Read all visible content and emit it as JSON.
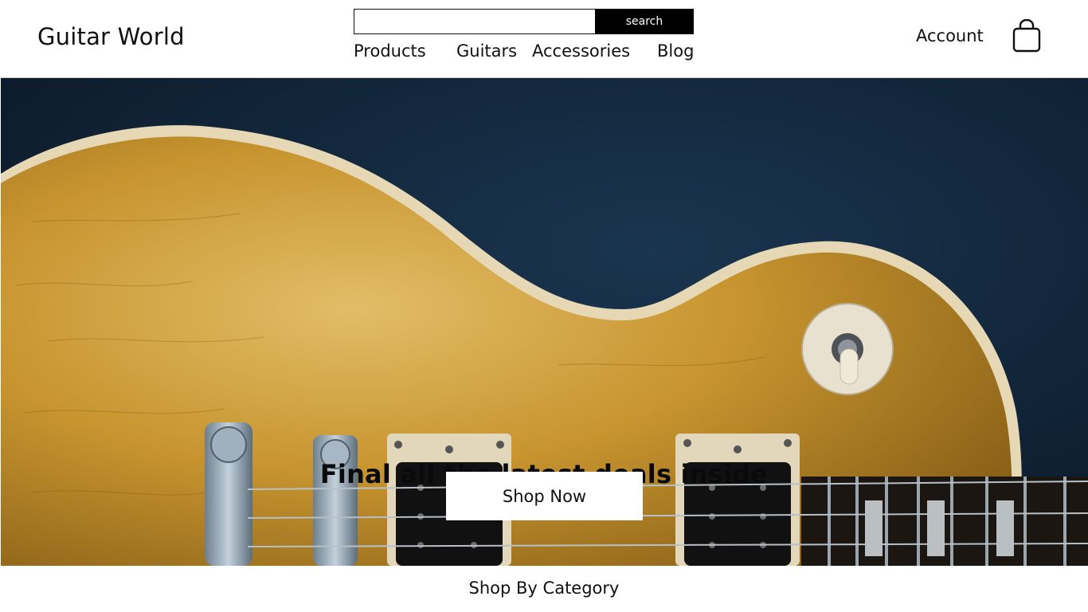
{
  "header": {
    "brand": "Guitar World",
    "search": {
      "value": "",
      "placeholder": "",
      "button_label": "search"
    },
    "nav": [
      {
        "label": "Products"
      },
      {
        "label": "Guitars"
      },
      {
        "label": "Accessories"
      },
      {
        "label": "Blog"
      }
    ],
    "account_label": "Account",
    "cart_icon": "shopping-bag-icon"
  },
  "hero": {
    "image": "gold-top-electric-guitar-body",
    "heading": "Final all the latest deals inside",
    "cta_label": "Shop Now"
  },
  "section": {
    "title": "Shop By Category"
  },
  "colors": {
    "background": "#ffffff",
    "text": "#111111",
    "search_button": "#000000",
    "hero_backdrop": "#0f2133",
    "guitar_gold": "#c9982f"
  }
}
